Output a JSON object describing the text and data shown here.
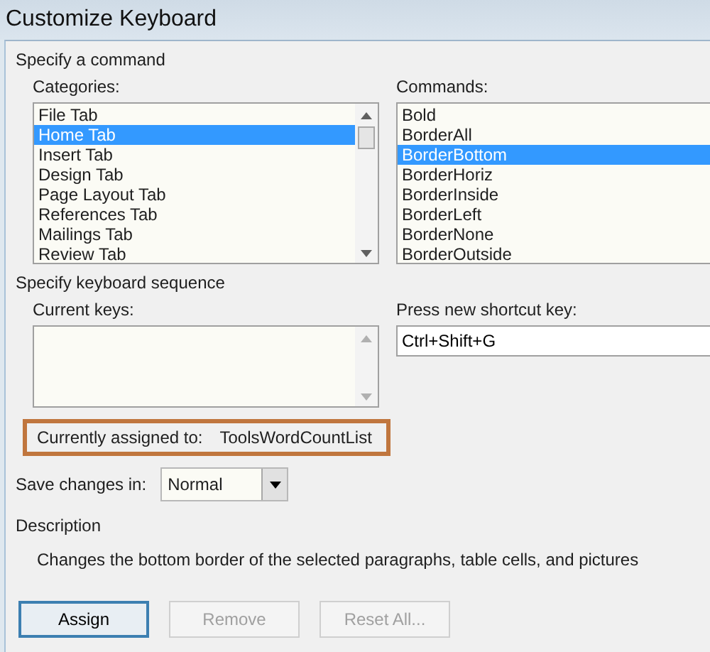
{
  "window": {
    "title": "Customize Keyboard"
  },
  "command_section": {
    "heading": "Specify a command",
    "categories": {
      "label": "Categories:",
      "items": [
        {
          "label": "File Tab",
          "selected": false
        },
        {
          "label": "Home Tab",
          "selected": true
        },
        {
          "label": "Insert Tab",
          "selected": false
        },
        {
          "label": "Design Tab",
          "selected": false
        },
        {
          "label": "Page Layout Tab",
          "selected": false
        },
        {
          "label": "References Tab",
          "selected": false
        },
        {
          "label": "Mailings Tab",
          "selected": false
        },
        {
          "label": "Review Tab",
          "selected": false
        }
      ]
    },
    "commands": {
      "label": "Commands:",
      "items": [
        {
          "label": "Bold",
          "selected": false
        },
        {
          "label": "BorderAll",
          "selected": false
        },
        {
          "label": "BorderBottom",
          "selected": true
        },
        {
          "label": "BorderHoriz",
          "selected": false
        },
        {
          "label": "BorderInside",
          "selected": false
        },
        {
          "label": "BorderLeft",
          "selected": false
        },
        {
          "label": "BorderNone",
          "selected": false
        },
        {
          "label": "BorderOutside",
          "selected": false
        }
      ]
    }
  },
  "keyboard_section": {
    "heading": "Specify keyboard sequence",
    "current_keys": {
      "label": "Current keys:"
    },
    "new_shortcut": {
      "label": "Press new shortcut key:",
      "value": "Ctrl+Shift+G"
    },
    "currently_assigned": {
      "label": "Currently assigned to:",
      "value": "ToolsWordCountList"
    }
  },
  "save_changes": {
    "label": "Save changes in:",
    "value": "Normal"
  },
  "description": {
    "heading": "Description",
    "text": "Changes the bottom border of the selected paragraphs, table cells, and pictures"
  },
  "buttons": [
    {
      "label": "Assign",
      "disabled": false
    },
    {
      "label": "Remove",
      "disabled": true
    },
    {
      "label": "Reset All...",
      "disabled": true
    }
  ]
}
